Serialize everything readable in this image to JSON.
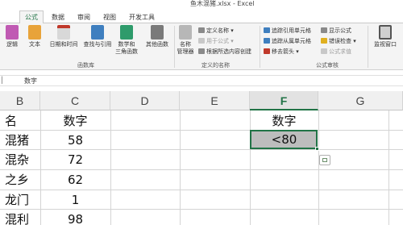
{
  "window": {
    "title": "鱼木混猪.xlsx - Excel"
  },
  "tabs": [
    {
      "label": "公式",
      "active": true
    },
    {
      "label": "数据"
    },
    {
      "label": "审阅"
    },
    {
      "label": "视图"
    },
    {
      "label": "开发工具"
    }
  ],
  "ribbon": {
    "function_library": {
      "group_label": "函数库",
      "buttons": [
        "逻辑",
        "文本",
        "日期和时间",
        "查找与引用",
        "数学和",
        "三角函数",
        "其他函数"
      ]
    },
    "defined_names": {
      "group_label": "定义的名称",
      "name_manager": [
        "名称",
        "管理器"
      ],
      "define_name": "定义名称",
      "use_in_formula": "用于公式",
      "create_from_selection": "根据所选内容创建"
    },
    "formula_auditing": {
      "group_label": "公式审核",
      "trace_precedents": "追踪引用单元格",
      "trace_dependents": "追踪从属单元格",
      "remove_arrows": "移去箭头",
      "show_formulas": "显示公式",
      "error_checking": "错误检查",
      "evaluate_formula": "公式求值"
    },
    "watch_window": "监视窗口"
  },
  "formula_bar": {
    "content": "数字"
  },
  "grid": {
    "columns": [
      "B",
      "C",
      "D",
      "E",
      "F",
      "G"
    ],
    "selected_column": "F",
    "column_b": [
      "名",
      "混猪",
      "混杂",
      "之乡",
      "龙门",
      "混利"
    ],
    "column_c": [
      "数字",
      "58",
      "72",
      "62",
      "1",
      "98"
    ],
    "column_f": [
      "数字",
      "<80"
    ]
  },
  "colors": {
    "accent": "#217346",
    "selection_fill": "#bdbdbd"
  }
}
